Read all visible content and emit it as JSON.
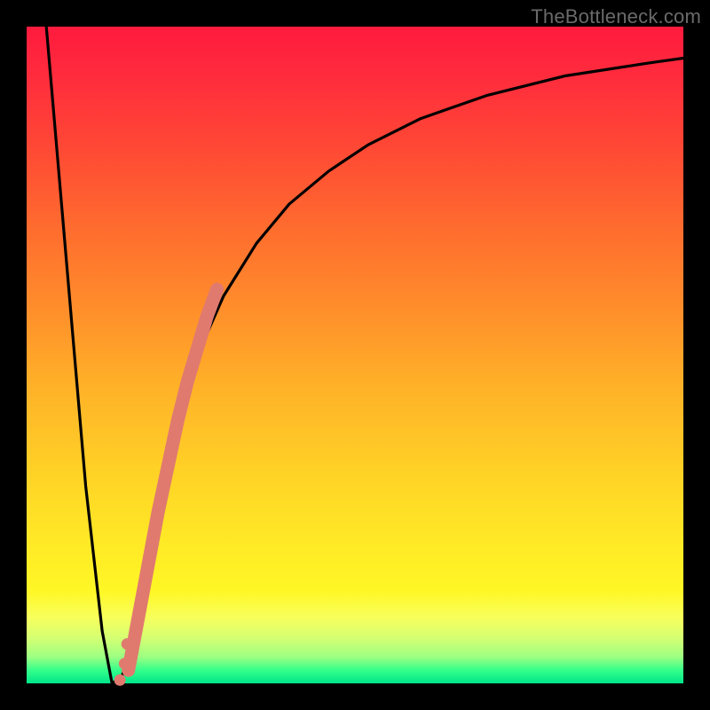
{
  "watermark": "TheBottleneck.com",
  "chart_data": {
    "type": "line",
    "title": "",
    "xlabel": "",
    "ylabel": "",
    "xlim": [
      0,
      100
    ],
    "ylim": [
      0,
      100
    ],
    "grid": false,
    "series": [
      {
        "name": "bottleneck-curve",
        "color": "#000000",
        "x": [
          3,
          6,
          9,
          11.5,
          13,
          14.5,
          16,
          18,
          20,
          23,
          26,
          30,
          35,
          40,
          46,
          52,
          60,
          70,
          82,
          95,
          100
        ],
        "y": [
          100,
          65,
          30,
          8,
          0,
          1,
          6,
          16,
          27,
          40,
          50,
          59,
          67,
          73,
          78,
          82,
          86,
          89.5,
          92.5,
          94.5,
          95.2
        ]
      }
    ],
    "highlight_segment": {
      "name": "marker-strip",
      "color": "#e07a6f",
      "x": [
        15.5,
        17,
        18.5,
        20,
        21.5,
        23,
        24.5,
        26,
        27.5,
        29
      ],
      "y": [
        2,
        10,
        18,
        26,
        33,
        40,
        46,
        51,
        56,
        60
      ]
    },
    "highlight_dots": {
      "name": "lower-dots",
      "color": "#e07a6f",
      "x": [
        14.2,
        14.9,
        15.3
      ],
      "y": [
        0.5,
        3,
        6
      ]
    }
  }
}
